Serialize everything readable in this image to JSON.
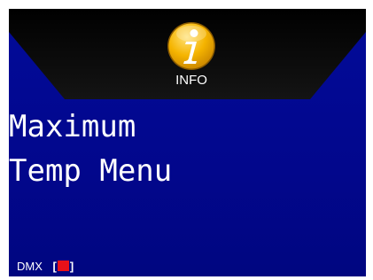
{
  "header": {
    "icon": "info-icon",
    "caption": "INFO"
  },
  "screen": {
    "title_line1": "Maximum",
    "title_line2": "Temp Menu"
  },
  "status": {
    "dmx_label": "DMX",
    "dmx_bracket_open": "[",
    "dmx_bracket_close": "]",
    "dmx_indicator_color": "#e8111a"
  },
  "colors": {
    "screen_background": "#020b99",
    "banner_background": "#0a0a0a",
    "icon_fill": "#f5b400",
    "text": "#ffffff"
  }
}
